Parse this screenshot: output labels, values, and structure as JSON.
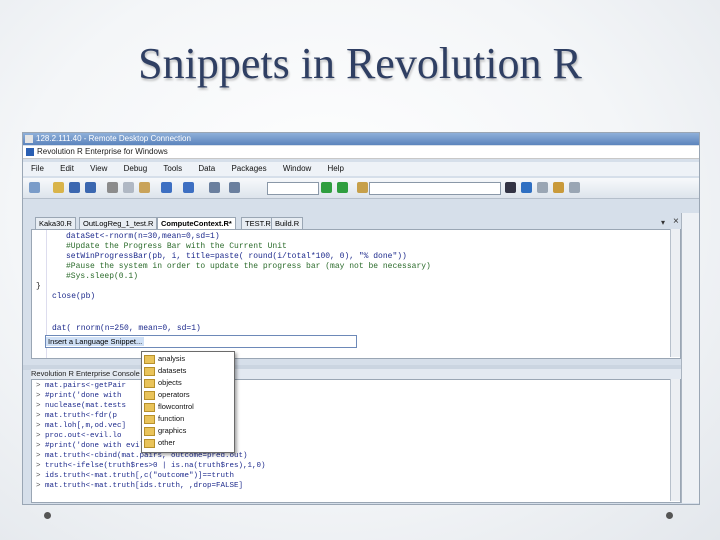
{
  "slide": {
    "title": "Snippets in Revolution R"
  },
  "remote_desktop": {
    "title": "128.2.111.40 - Remote Desktop Connection"
  },
  "app": {
    "title": "Revolution R Enterprise for Windows"
  },
  "menu": [
    "File",
    "Edit",
    "View",
    "Debug",
    "Tools",
    "Data",
    "Packages",
    "Window",
    "Help"
  ],
  "tabs": [
    "Kaka30.R",
    "OutLogReg_1_test.R",
    "ComputeContext.R*",
    "TEST.R",
    "Build.R"
  ],
  "editor": {
    "lines": [
      "dataSet<-rnorm(n=30,mean=0,sd=1)",
      "#Update the Progress Bar with the Current Unit",
      "setWinProgressBar(pb, i, title=paste( round(i/total*100, 0), \"% done\"))",
      "#Pause the system in order to update the progress bar (may not be necessary)",
      "#Sys.sleep(0.1)",
      "}",
      "close(pb)",
      "",
      "dat( rnorm(n=250, mean=0, sd=1)"
    ],
    "snippet_prompt": "Insert a Language Snippet..."
  },
  "snippet_menu": {
    "items": [
      "analysis",
      "datasets",
      "objects",
      "operators",
      "flowcontrol",
      "function",
      "graphics",
      "other"
    ]
  },
  "console": {
    "title": "Revolution R Enterprise Console",
    "lines": [
      "mat.pairs<-getPair",
      "#print('done with",
      "nuclease(mat.tests",
      "mat.truth<-fdr(p",
      "mat.loh[,m,od.vec]",
      "proc.out<-evil.lo",
      "#print('done with evil.loops in initial')",
      "mat.truth<-cbind(mat.pairs, outcome=pred.out)",
      "truth<-ifelse(truth$res>0 | is.na(truth$res),1,0)",
      "ids.truth<-mat.truth[,c(\"outcome\")]==truth",
      "mat.truth<-mat.truth[ids.truth, ,drop=FALSE]"
    ]
  },
  "colors": {
    "slide_title": "#2f3f63",
    "titlebar": "#5c84bd",
    "code": "#1d2a8c",
    "comment": "#2b6b2b"
  }
}
